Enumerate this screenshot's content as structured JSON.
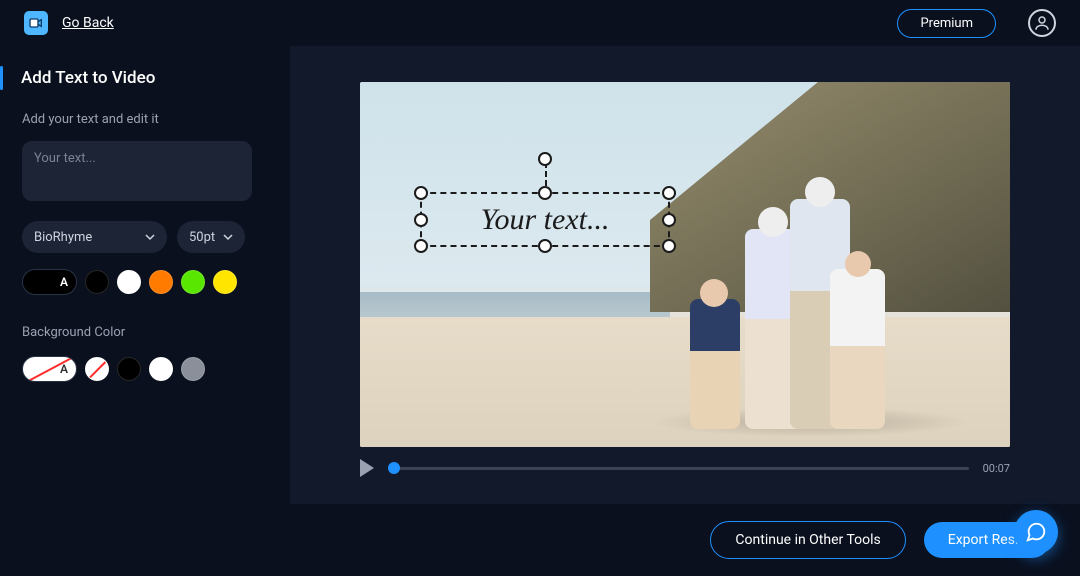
{
  "topbar": {
    "go_back": "Go Back",
    "premium": "Premium"
  },
  "sidebar": {
    "title": "Add Text to Video",
    "subtitle": "Add your text and edit it",
    "placeholder": "Your text...",
    "font_select": "BioRhyme",
    "size_select": "50pt",
    "text_colors": [
      "#000000",
      "#ffffff",
      "#ff7b00",
      "#59e600",
      "#ffe500"
    ],
    "bg_label": "Background Color",
    "bg_colors": [
      "none",
      "#000000",
      "#ffffff",
      "#8a8f99"
    ]
  },
  "canvas": {
    "overlay_text": "Your text..."
  },
  "player": {
    "duration": "00:07"
  },
  "footer": {
    "continue": "Continue in Other Tools",
    "export": "Export Res..."
  }
}
